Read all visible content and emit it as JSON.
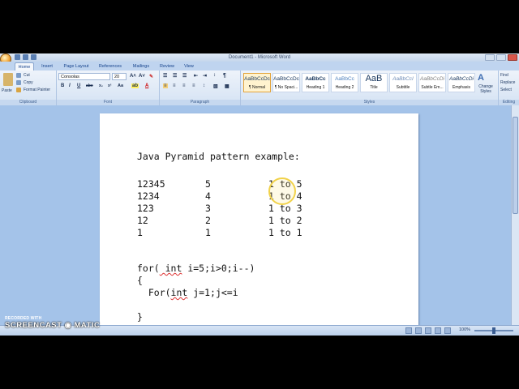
{
  "window": {
    "title": "Document1 - Microsoft Word"
  },
  "tabs": [
    "Home",
    "Insert",
    "Page Layout",
    "References",
    "Mailings",
    "Review",
    "View"
  ],
  "active_tab": "Home",
  "ribbon": {
    "clipboard": {
      "paste": "Paste",
      "cut": "Cut",
      "copy": "Copy",
      "format_painter": "Format Painter",
      "label": "Clipboard"
    },
    "font": {
      "name": "Consolas",
      "size": "20",
      "label": "Font"
    },
    "paragraph": {
      "label": "Paragraph"
    },
    "styles": {
      "label": "Styles",
      "items": [
        {
          "preview": "AaBbCcDc",
          "name": "¶ Normal"
        },
        {
          "preview": "AaBbCcDc",
          "name": "¶ No Spaci..."
        },
        {
          "preview": "AaBbCc",
          "name": "Heading 1"
        },
        {
          "preview": "AaBbCc",
          "name": "Heading 2"
        },
        {
          "preview": "AaB",
          "name": "Title"
        },
        {
          "preview": "AaBbCcI",
          "name": "Subtitle"
        },
        {
          "preview": "AaBbCcDi",
          "name": "Subtle Em..."
        },
        {
          "preview": "AaBbCcDi",
          "name": "Emphasis"
        }
      ],
      "change_styles": "Change Styles"
    },
    "editing": {
      "find": "Find",
      "replace": "Replace",
      "select": "Select",
      "label": "Editing"
    }
  },
  "document": {
    "heading": "Java Pyramid pattern example:",
    "rows": [
      {
        "pattern": "12345",
        "count": "5",
        "range": "1 to 5"
      },
      {
        "pattern": "1234",
        "count": "4",
        "range": "1 to 4"
      },
      {
        "pattern": "123",
        "count": "3",
        "range": "1 to 3"
      },
      {
        "pattern": "12",
        "count": "2",
        "range": "1 to 2"
      },
      {
        "pattern": "1",
        "count": "1",
        "range": "1 to 1"
      }
    ],
    "code": {
      "line1_a": "for(",
      "line1_b": " int",
      "line1_c": " i=5;i>0;i--)",
      "line2": "{",
      "line3_a": "  For(",
      "line3_b": "int",
      "line3_c": " j=1;j<=i",
      "line4": "}"
    }
  },
  "status": {
    "zoom": "100%"
  },
  "watermark": {
    "top": "RECORDED WITH",
    "main": "SCREENCAST ◉ MATIC"
  },
  "colors": {
    "ribbon_bg": "#d5e3f4",
    "doc_bg": "#a4c3e9",
    "highlight_ring": "#f1d24a"
  }
}
